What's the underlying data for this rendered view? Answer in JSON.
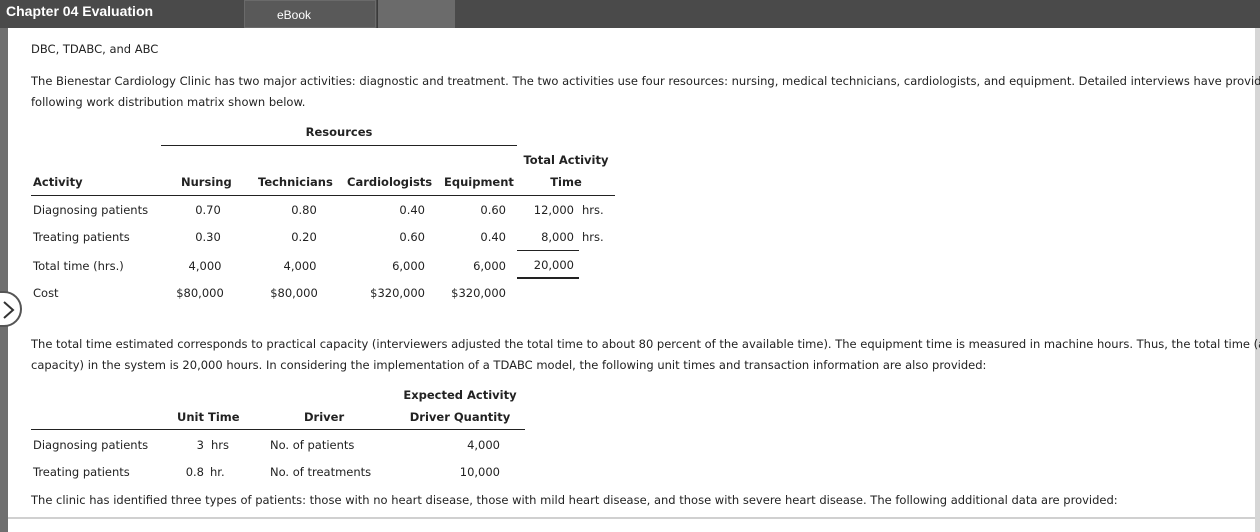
{
  "app": {
    "title": "Chapter 04 Evaluation",
    "tab_label": "eBook"
  },
  "content": {
    "heading": "DBC, TDABC, and ABC",
    "intro_line1": "The Bienestar Cardiology Clinic has two major activities: diagnostic and treatment. The two activities use four resources: nursing, medical technicians, cardiologists, and equipment. Detailed interviews have provided the",
    "intro_line2": "following work distribution matrix shown below.",
    "para2_line1": "The total time estimated corresponds to practical capacity (interviewers adjusted the total time to about 80 percent of the available time). The equipment time is measured in machine hours. Thus, the total time (at practical",
    "para2_line2": "capacity) in the system is 20,000 hours. In considering the implementation of a TDABC model, the following unit times and transaction information are also provided:",
    "para3": "The clinic has identified three types of patients: those with no heart disease, those with mild heart disease, and those with severe heart disease. The following additional data are provided:"
  },
  "matrix": {
    "resources_header": "Resources",
    "total_header_line1": "Total Activity",
    "total_header_line2": "Time",
    "columns": [
      "Activity",
      "Nursing",
      "Technicians",
      "Cardiologists",
      "Equipment"
    ],
    "rows": [
      {
        "label": "Diagnosing patients",
        "nursing": "0.70",
        "technicians": "0.80",
        "cardiologists": "0.40",
        "equipment": "0.60",
        "total": "12,000",
        "unit": "hrs."
      },
      {
        "label": "Treating patients",
        "nursing": "0.30",
        "technicians": "0.20",
        "cardiologists": "0.60",
        "equipment": "0.40",
        "total": "8,000",
        "unit": "hrs."
      },
      {
        "label": "Total time (hrs.)",
        "nursing": "4,000",
        "technicians": "4,000",
        "cardiologists": "6,000",
        "equipment": "6,000",
        "total": "20,000",
        "unit": ""
      },
      {
        "label": "Cost",
        "nursing": "$80,000",
        "technicians": "$80,000",
        "cardiologists": "$320,000",
        "equipment": "$320,000",
        "total": "",
        "unit": ""
      }
    ]
  },
  "tdabc": {
    "unit_time_header": "Unit Time",
    "driver_header": "Driver",
    "quantity_header_line1": "Expected Activity",
    "quantity_header_line2": "Driver Quantity",
    "rows": [
      {
        "label": "Diagnosing patients",
        "unit_time": "3",
        "unit": "hrs",
        "driver": "No. of patients",
        "quantity": "4,000"
      },
      {
        "label": "Treating patients",
        "unit_time": "0.8",
        "unit": "hr.",
        "driver": "No. of treatments",
        "quantity": "10,000"
      }
    ]
  }
}
